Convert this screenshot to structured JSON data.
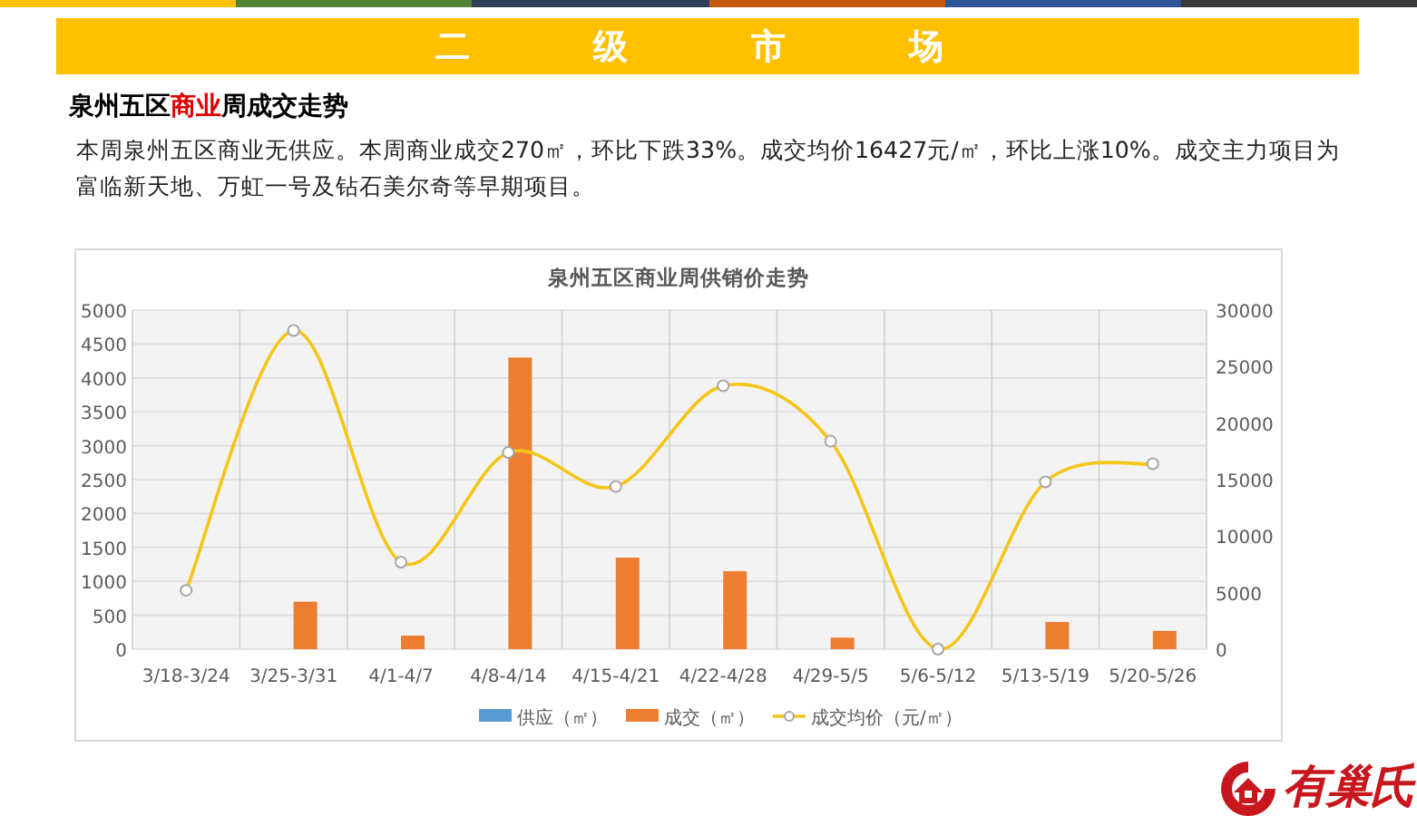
{
  "stripe": [
    {
      "color": "#ffc000"
    },
    {
      "color": "#548235"
    },
    {
      "color": "#2f3f5a"
    },
    {
      "color": "#c55a11"
    },
    {
      "color": "#2e5597"
    },
    {
      "color": "#3b3838"
    }
  ],
  "banner": {
    "title": [
      "二",
      "级",
      "市",
      "场"
    ]
  },
  "section": {
    "heading": [
      {
        "text": "泉州五区",
        "highlight": false
      },
      {
        "text": "商业",
        "highlight": true
      },
      {
        "text": "周成交走势",
        "highlight": false
      }
    ],
    "summary": "本周泉州五区商业无供应。本周商业成交270㎡，环比下跌33%。成交均价16427元/㎡，环比上涨10%。成交主力项目为富临新天地、万虹一号及钻石美尔奇等早期项目。"
  },
  "chart": {
    "chart_data": {
      "type": "bar",
      "title": "泉州五区商业周供销价走势",
      "categories": [
        "3/18-3/24",
        "3/25-3/31",
        "4/1-4/7",
        "4/8-4/14",
        "4/15-4/21",
        "4/22-4/28",
        "4/29-5/5",
        "5/6-5/12",
        "5/13-5/19",
        "5/20-5/26"
      ],
      "series": [
        {
          "name": "供应（㎡）",
          "type": "bar",
          "color": "#5b9bd5",
          "values": [
            0,
            0,
            0,
            0,
            0,
            0,
            0,
            0,
            0,
            0
          ]
        },
        {
          "name": "成交（㎡）",
          "type": "bar",
          "color": "#ed7d31",
          "values": [
            0,
            700,
            200,
            4300,
            1350,
            1150,
            170,
            0,
            400,
            270
          ]
        },
        {
          "name": "成交均价（元/㎡）",
          "type": "line",
          "axis": "y2",
          "marker": "circle",
          "color": "#f5c518",
          "values": [
            5200,
            28200,
            7700,
            17400,
            14400,
            23300,
            18400,
            0,
            14800,
            16400
          ]
        }
      ],
      "ylim": [
        0,
        5000
      ],
      "yticks": [
        0,
        500,
        1000,
        1500,
        2000,
        2500,
        3000,
        3500,
        4000,
        4500,
        5000
      ],
      "grid": true,
      "legend": "bottom",
      "y2lim": [
        0,
        30000
      ],
      "y2ticks": [
        0,
        5000,
        10000,
        15000,
        20000,
        25000,
        30000
      ]
    }
  },
  "logo": {
    "text": "有巢氏"
  }
}
